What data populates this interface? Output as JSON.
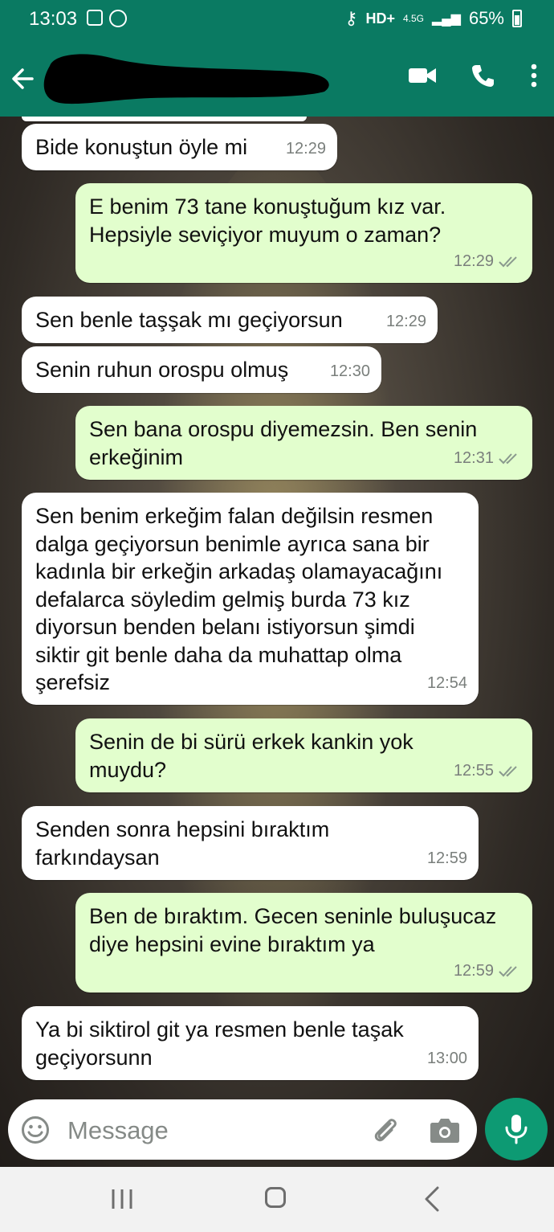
{
  "status_bar": {
    "time": "13:03",
    "network": "4.5G",
    "battery": "65%"
  },
  "header": {
    "contact_name": ""
  },
  "messages": [
    {
      "dir": "in",
      "text": "Bide konuştun öyle mi",
      "time": "12:29"
    },
    {
      "dir": "out",
      "text": "E benim 73 tane konuştuğum kız var. Hepsiyle seviçiyor muyum o zaman?",
      "time": "12:29"
    },
    {
      "dir": "in",
      "text": "Sen benle taşşak mı geçiyorsun",
      "time": "12:29"
    },
    {
      "dir": "in",
      "text": "Senin ruhun orospu olmuş",
      "time": "12:30"
    },
    {
      "dir": "out",
      "text": "Sen bana orospu diyemezsin. Ben senin erkeğinim",
      "time": "12:31"
    },
    {
      "dir": "in",
      "text": "Sen benim erkeğim falan değilsin resmen dalga geçiyorsun benimle ayrıca sana bir kadınla bir erkeğin arkadaş olamayacağını defalarca söyledim gelmiş burda 73 kız diyorsun benden belanı istiyorsun şimdi siktir git benle daha da muhattap olma şerefsiz",
      "time": "12:54"
    },
    {
      "dir": "out",
      "text": "Senin de bi sürü erkek kankin yok muydu?",
      "time": "12:55"
    },
    {
      "dir": "in",
      "text": "Senden sonra hepsini bıraktım farkındaysan",
      "time": "12:59"
    },
    {
      "dir": "out",
      "text": "Ben de bıraktım. Gecen seninle buluşucaz diye hepsini evine bıraktım ya",
      "time": "12:59"
    },
    {
      "dir": "in",
      "text": "Ya bi siktirol git ya resmen benle taşak geçiyorsunn",
      "time": "13:00"
    }
  ],
  "composer": {
    "placeholder": "Message"
  },
  "colors": {
    "header": "#0a7a62",
    "outgoing_bubble": "#e2fecd",
    "incoming_bubble": "#ffffff",
    "mic_button": "#0d9a73"
  },
  "icons": [
    "back-arrow-icon",
    "video-call-icon",
    "phone-icon",
    "more-vert-icon",
    "emoji-icon",
    "attach-icon",
    "camera-icon",
    "mic-icon"
  ]
}
